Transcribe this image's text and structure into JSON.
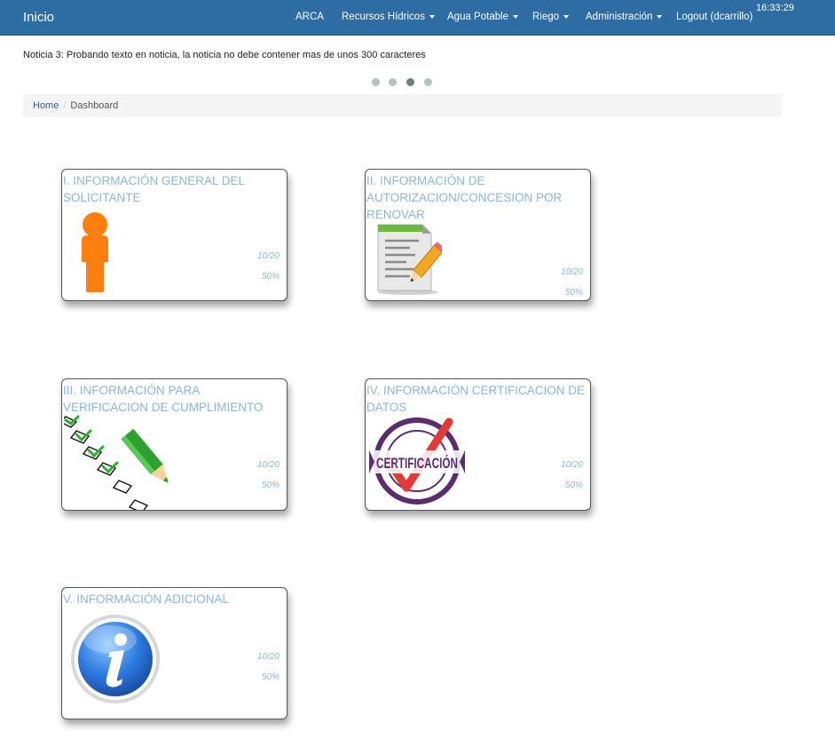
{
  "navbar": {
    "brand": "Inicio",
    "items": [
      {
        "label": "ARCA",
        "dropdown": false
      },
      {
        "label": "Recursos Hídricos",
        "dropdown": true
      },
      {
        "label": "Agua Potable",
        "dropdown": true
      },
      {
        "label": "Riego",
        "dropdown": true
      },
      {
        "label": "Administración",
        "dropdown": true
      },
      {
        "label": "Logout (dcarrillo)",
        "dropdown": false
      }
    ],
    "clock": "16:33:29"
  },
  "news": {
    "text": "Noticia 3: Probando texto en noticia, la noticia no debe contener mas de unos 300 caracteres",
    "slide_count": 4,
    "active_slide": 3
  },
  "breadcrumb": {
    "home": "Home",
    "current": "Dashboard"
  },
  "cards": [
    {
      "title": "I. INFORMACIÓN GENERAL DEL SOLICITANTE",
      "count": "10/20",
      "percent": "50%",
      "icon": "person-icon"
    },
    {
      "title": "II. INFORMACIÓN DE AUTORIZACION/CONCESION POR RENOVAR",
      "count": "10/20",
      "percent": "50%",
      "icon": "document-edit-icon"
    },
    {
      "title": "III. INFORMACIÓN PARA VERIFICACION DE CUMPLIMIENTO",
      "count": "10/20",
      "percent": "50%",
      "icon": "checklist-icon"
    },
    {
      "title": "IV. INFORMACIÓN CERTIFICACION DE DATOS",
      "count": "10/20",
      "percent": "50%",
      "icon": "certification-seal-icon",
      "icon_text": "CERTIFICACIÓN"
    },
    {
      "title": "V. INFORMACIÓN ADICIONAL",
      "count": "10/20",
      "percent": "50%",
      "icon": "info-icon"
    }
  ],
  "colors": {
    "navbar_bg": "#2e6da4",
    "card_title": "#8ab7dc",
    "breadcrumb_bg": "#f5f5f5"
  }
}
